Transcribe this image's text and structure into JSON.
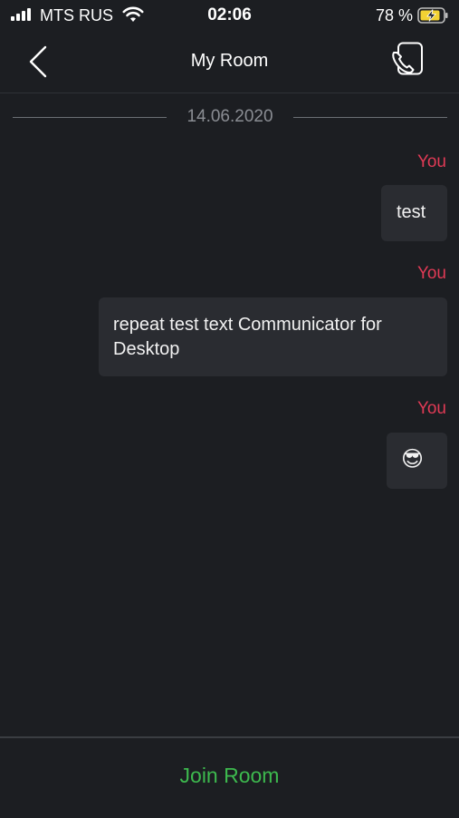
{
  "status_bar": {
    "carrier": "MTS RUS",
    "time": "02:06",
    "battery_percent": "78 %"
  },
  "nav": {
    "title": "My Room",
    "back_icon": "chevron-left-icon",
    "call_icon": "phone-call-icon"
  },
  "chat": {
    "date_separator": "14.06.2020",
    "messages": [
      {
        "sender": "You",
        "text": "test"
      },
      {
        "sender": "You",
        "text": "repeat test text Communicator for Desktop"
      },
      {
        "sender": "You",
        "text": "😎"
      }
    ]
  },
  "footer": {
    "join_label": "Join Room"
  },
  "colors": {
    "background": "#1c1e22",
    "bubble": "#2a2c31",
    "sender": "#e03a55",
    "join": "#3db94e"
  }
}
